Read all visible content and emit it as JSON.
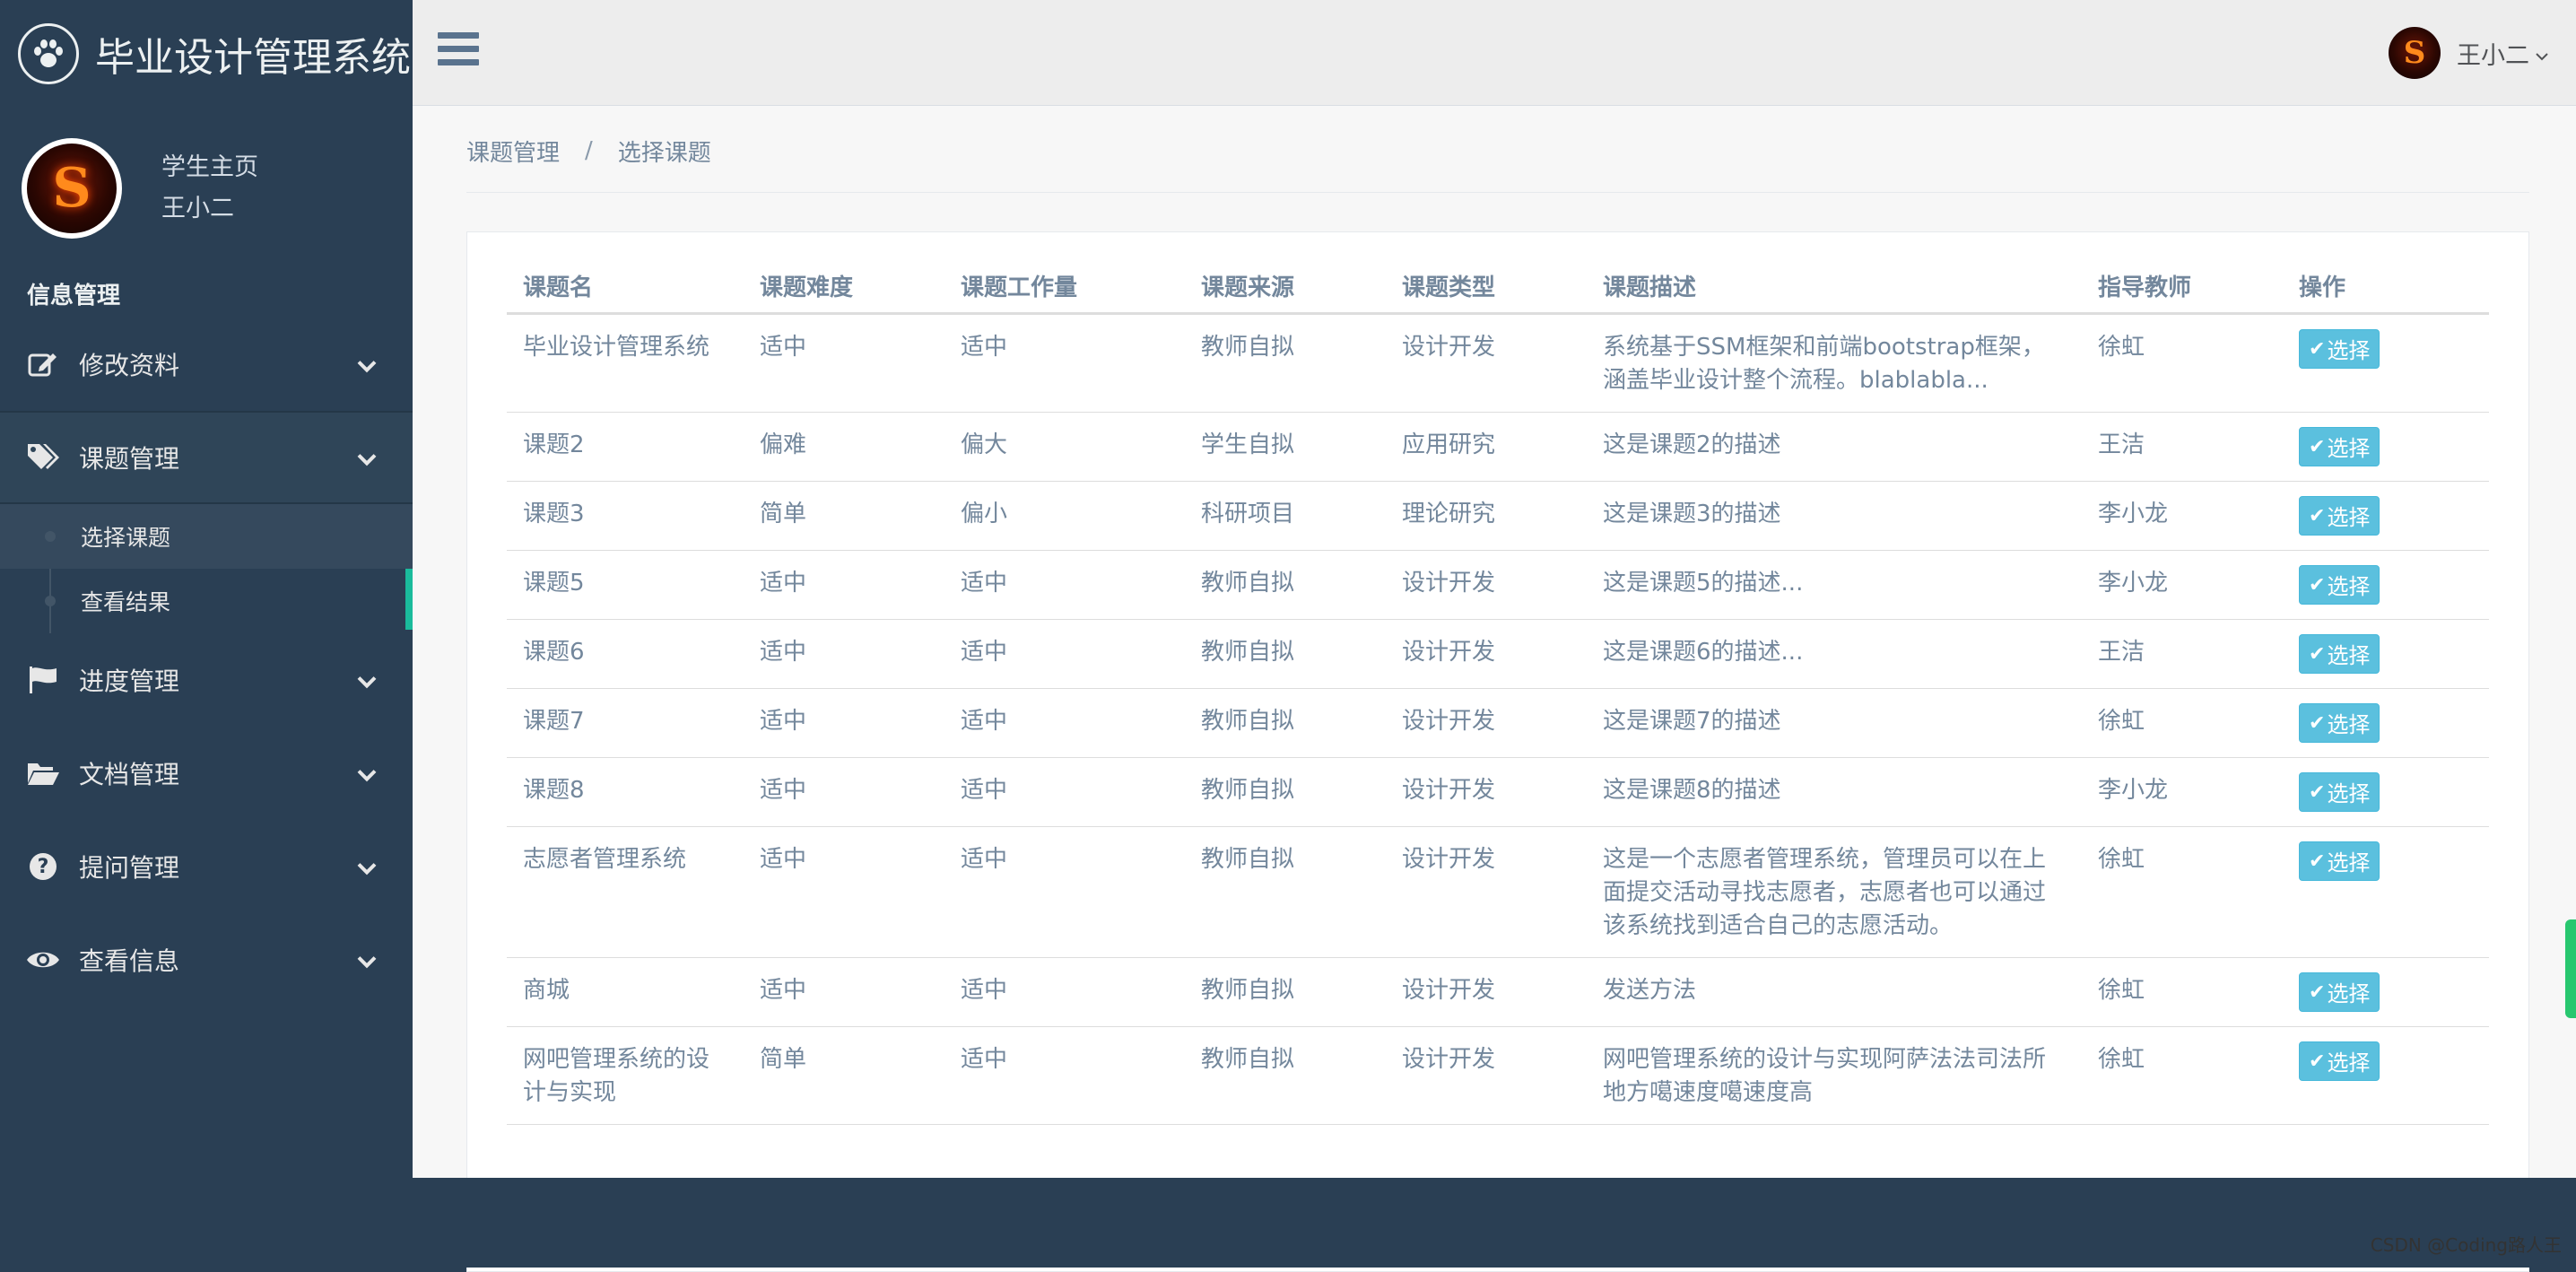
{
  "brand": {
    "title": "毕业设计管理系统",
    "icon": "paw-icon"
  },
  "profile": {
    "role": "学生主页",
    "name": "王小二",
    "avatar_letter": "S"
  },
  "sidebar": {
    "section_title": "信息管理",
    "items": [
      {
        "label": "修改资料",
        "icon": "edit-icon"
      },
      {
        "label": "课题管理",
        "icon": "tags-icon",
        "submenu": [
          "选择课题",
          "查看结果"
        ]
      },
      {
        "label": "进度管理",
        "icon": "flag-icon"
      },
      {
        "label": "文档管理",
        "icon": "folder-open-icon"
      },
      {
        "label": "提问管理",
        "icon": "question-circle-icon"
      },
      {
        "label": "查看信息",
        "icon": "eye-icon"
      }
    ]
  },
  "topbar": {
    "user_name": "王小二",
    "avatar_letter": "S"
  },
  "breadcrumb": {
    "items": [
      "课题管理",
      "选择课题"
    ],
    "separator": "/"
  },
  "table": {
    "headers": [
      "课题名",
      "课题难度",
      "课题工作量",
      "课题来源",
      "课题类型",
      "课题描述",
      "指导教师",
      "操作"
    ],
    "action_label": "选择",
    "rows": [
      [
        "毕业设计管理系统",
        "适中",
        "适中",
        "教师自拟",
        "设计开发",
        "系统基于SSM框架和前端bootstrap框架，涵盖毕业设计整个流程。blablabla...",
        "徐虹"
      ],
      [
        "课题2",
        "偏难",
        "偏大",
        "学生自拟",
        "应用研究",
        "这是课题2的描述",
        "王洁"
      ],
      [
        "课题3",
        "简单",
        "偏小",
        "科研项目",
        "理论研究",
        "这是课题3的描述",
        "李小龙"
      ],
      [
        "课题5",
        "适中",
        "适中",
        "教师自拟",
        "设计开发",
        "这是课题5的描述...",
        "李小龙"
      ],
      [
        "课题6",
        "适中",
        "适中",
        "教师自拟",
        "设计开发",
        "这是课题6的描述...",
        "王洁"
      ],
      [
        "课题7",
        "适中",
        "适中",
        "教师自拟",
        "设计开发",
        "这是课题7的描述",
        "徐虹"
      ],
      [
        "课题8",
        "适中",
        "适中",
        "教师自拟",
        "设计开发",
        "这是课题8的描述",
        "李小龙"
      ],
      [
        "志愿者管理系统",
        "适中",
        "适中",
        "教师自拟",
        "设计开发",
        "这是一个志愿者管理系统，管理员可以在上面提交活动寻找志愿者，志愿者也可以通过该系统找到适合自己的志愿活动。",
        "徐虹"
      ],
      [
        "商城",
        "适中",
        "适中",
        "教师自拟",
        "设计开发",
        "发送方法",
        "徐虹"
      ],
      [
        "网吧管理系统的设计与实现",
        "简单",
        "适中",
        "教师自拟",
        "设计开发",
        "网吧管理系统的设计与实现阿萨法法司法所地方噶速度噶速度高",
        "徐虹"
      ]
    ]
  },
  "watermark": "CSDN @Coding路人王",
  "colors": {
    "sidebar": "#2a3f54",
    "accent": "#1abb9c",
    "info_button": "#5bc0de",
    "text": "#73879c"
  }
}
